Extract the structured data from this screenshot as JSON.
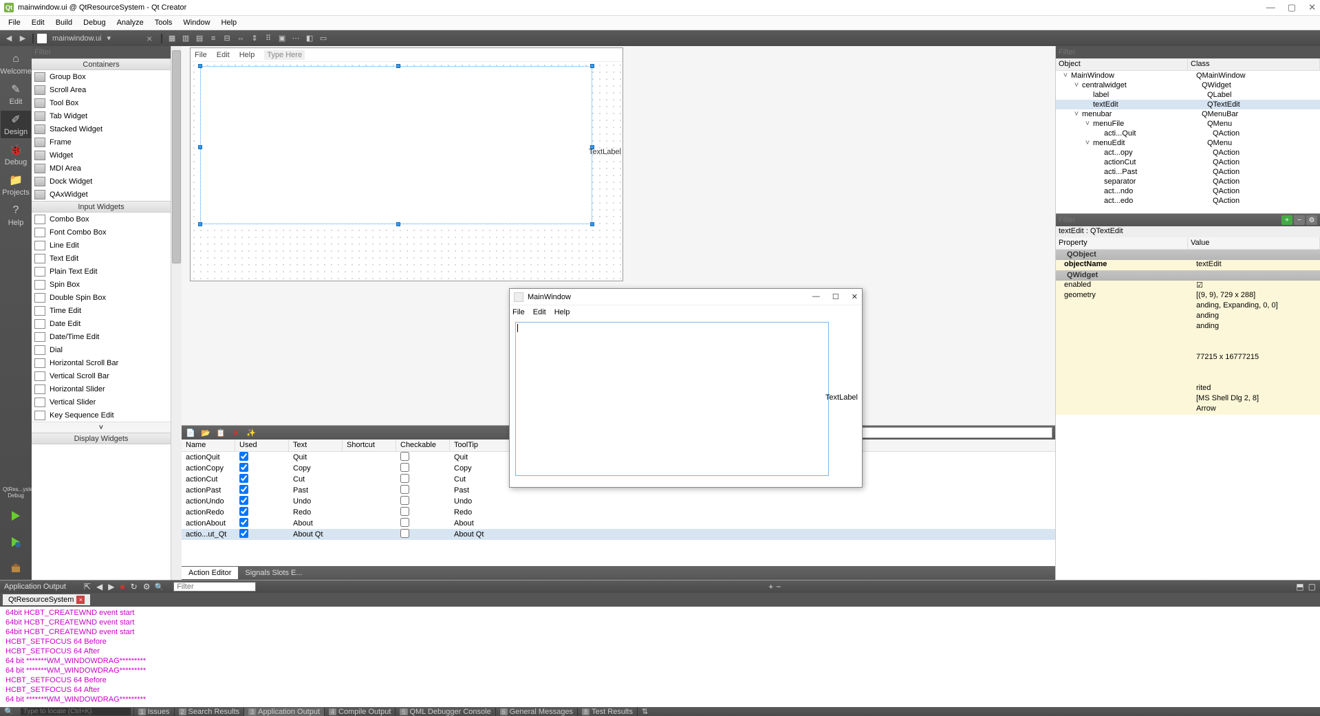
{
  "app": {
    "title": "mainwindow.ui @ QtResourceSystem - Qt Creator"
  },
  "menubar": [
    "File",
    "Edit",
    "Build",
    "Debug",
    "Analyze",
    "Tools",
    "Window",
    "Help"
  ],
  "toolbar": {
    "doc": "mainwindow.ui"
  },
  "modes": [
    {
      "name": "Welcome",
      "active": false
    },
    {
      "name": "Edit",
      "active": false
    },
    {
      "name": "Design",
      "active": true
    },
    {
      "name": "Debug",
      "active": false
    },
    {
      "name": "Projects",
      "active": false
    },
    {
      "name": "Help",
      "active": false
    }
  ],
  "kit": "QtRes...ystem\nDebug",
  "widgetbox": {
    "filter_ph": "Filter",
    "cat1": "Containers",
    "items1": [
      "Group Box",
      "Scroll Area",
      "Tool Box",
      "Tab Widget",
      "Stacked Widget",
      "Frame",
      "Widget",
      "MDI Area",
      "Dock Widget",
      "QAxWidget"
    ],
    "cat2": "Input Widgets",
    "items2": [
      "Combo Box",
      "Font Combo Box",
      "Line Edit",
      "Text Edit",
      "Plain Text Edit",
      "Spin Box",
      "Double Spin Box",
      "Time Edit",
      "Date Edit",
      "Date/Time Edit",
      "Dial",
      "Horizontal Scroll Bar",
      "Vertical Scroll Bar",
      "Horizontal Slider",
      "Vertical Slider",
      "Key Sequence Edit"
    ],
    "cat3": "Display Widgets"
  },
  "form": {
    "menu": [
      "File",
      "Edit",
      "Help"
    ],
    "typehere": "Type Here",
    "textlabel": "TextLabel"
  },
  "actions": {
    "filter_ph": "Filter",
    "headers": [
      "Name",
      "Used",
      "Text",
      "Shortcut",
      "Checkable",
      "ToolTip"
    ],
    "rows": [
      {
        "name": "actionQuit",
        "used": true,
        "text": "Quit",
        "short": "",
        "check": false,
        "tip": "Quit"
      },
      {
        "name": "actionCopy",
        "used": true,
        "text": "Copy",
        "short": "",
        "check": false,
        "tip": "Copy"
      },
      {
        "name": "actionCut",
        "used": true,
        "text": "Cut",
        "short": "",
        "check": false,
        "tip": "Cut"
      },
      {
        "name": "actionPast",
        "used": true,
        "text": "Past",
        "short": "",
        "check": false,
        "tip": "Past"
      },
      {
        "name": "actionUndo",
        "used": true,
        "text": "Undo",
        "short": "",
        "check": false,
        "tip": "Undo"
      },
      {
        "name": "actionRedo",
        "used": true,
        "text": "Redo",
        "short": "",
        "check": false,
        "tip": "Redo"
      },
      {
        "name": "actionAbout",
        "used": true,
        "text": "About",
        "short": "",
        "check": false,
        "tip": "About"
      },
      {
        "name": "actio...ut_Qt",
        "used": true,
        "text": "About Qt",
        "short": "",
        "check": false,
        "tip": "About Qt"
      }
    ],
    "tabs": [
      "Action Editor",
      "Signals  Slots E..."
    ]
  },
  "objectTree": {
    "filter_ph": "Filter",
    "h1": "Object",
    "h2": "Class",
    "rows": [
      {
        "ind": 0,
        "exp": "˅",
        "obj": "MainWindow",
        "cls": "QMainWindow"
      },
      {
        "ind": 1,
        "exp": "˅",
        "obj": "centralwidget",
        "cls": "QWidget",
        "icon": "grid"
      },
      {
        "ind": 2,
        "exp": "",
        "obj": "label",
        "cls": "QLabel"
      },
      {
        "ind": 2,
        "exp": "",
        "obj": "textEdit",
        "cls": "QTextEdit",
        "sel": true
      },
      {
        "ind": 1,
        "exp": "˅",
        "obj": "menubar",
        "cls": "QMenuBar"
      },
      {
        "ind": 2,
        "exp": "˅",
        "obj": "menuFile",
        "cls": "QMenu"
      },
      {
        "ind": 3,
        "exp": "",
        "obj": "acti...Quit",
        "cls": "QAction"
      },
      {
        "ind": 2,
        "exp": "˅",
        "obj": "menuEdit",
        "cls": "QMenu"
      },
      {
        "ind": 3,
        "exp": "",
        "obj": "act...opy",
        "cls": "QAction"
      },
      {
        "ind": 3,
        "exp": "",
        "obj": "actionCut",
        "cls": "QAction"
      },
      {
        "ind": 3,
        "exp": "",
        "obj": "acti...Past",
        "cls": "QAction"
      },
      {
        "ind": 3,
        "exp": "",
        "obj": "separator",
        "cls": "QAction"
      },
      {
        "ind": 3,
        "exp": "",
        "obj": "act...ndo",
        "cls": "QAction"
      },
      {
        "ind": 3,
        "exp": "",
        "obj": "act...edo",
        "cls": "QAction"
      }
    ]
  },
  "properties": {
    "filter_ph": "Filter",
    "name": "textEdit : QTextEdit",
    "h1": "Property",
    "h2": "Value",
    "groups": [
      {
        "cat": "QObject",
        "rows": [
          {
            "p": "objectName",
            "v": "textEdit",
            "bold": true
          }
        ]
      },
      {
        "cat": "QWidget",
        "rows": [
          {
            "p": "enabled",
            "v": "☑"
          },
          {
            "p": "geometry",
            "v": "[(9, 9), 729 x 288]"
          },
          {
            "p": "",
            "v": "anding, Expanding, 0, 0]"
          },
          {
            "p": "",
            "v": "anding"
          },
          {
            "p": "",
            "v": "anding"
          },
          {
            "p": "",
            "v": ""
          },
          {
            "p": "",
            "v": ""
          },
          {
            "p": "",
            "v": "77215 x 16777215"
          },
          {
            "p": "",
            "v": ""
          },
          {
            "p": "",
            "v": ""
          },
          {
            "p": "",
            "v": "rited"
          },
          {
            "p": "",
            "v": "[MS Shell Dlg 2, 8]"
          },
          {
            "p": "",
            "v": "Arrow"
          }
        ]
      }
    ]
  },
  "output": {
    "title": "Application Output",
    "filter_ph": "Filter",
    "tab": "QtResourceSystem",
    "lines": [
      "64bit HCBT_CREATEWND event start",
      "64bit HCBT_CREATEWND event start",
      "64bit HCBT_CREATEWND event start",
      " HCBT_SETFOCUS 64 Before",
      " HCBT_SETFOCUS 64 After",
      "64 bit *******WM_WINDOWDRAG*********",
      "64 bit *******WM_WINDOWDRAG*********",
      " HCBT_SETFOCUS 64 Before",
      " HCBT_SETFOCUS 64 After",
      "64 bit *******WM_WINDOWDRAG*********"
    ]
  },
  "status": {
    "search_ph": "Type to locate (Ctrl+K)",
    "panels": [
      {
        "n": "1",
        "t": "Issues"
      },
      {
        "n": "2",
        "t": "Search Results"
      },
      {
        "n": "3",
        "t": "Application Output",
        "active": true
      },
      {
        "n": "4",
        "t": "Compile Output"
      },
      {
        "n": "5",
        "t": "QML Debugger Console"
      },
      {
        "n": "6",
        "t": "General Messages"
      },
      {
        "n": "8",
        "t": "Test Results"
      }
    ]
  },
  "floatwin": {
    "title": "MainWindow",
    "menu": [
      "File",
      "Edit",
      "Help"
    ],
    "label": "TextLabel"
  }
}
